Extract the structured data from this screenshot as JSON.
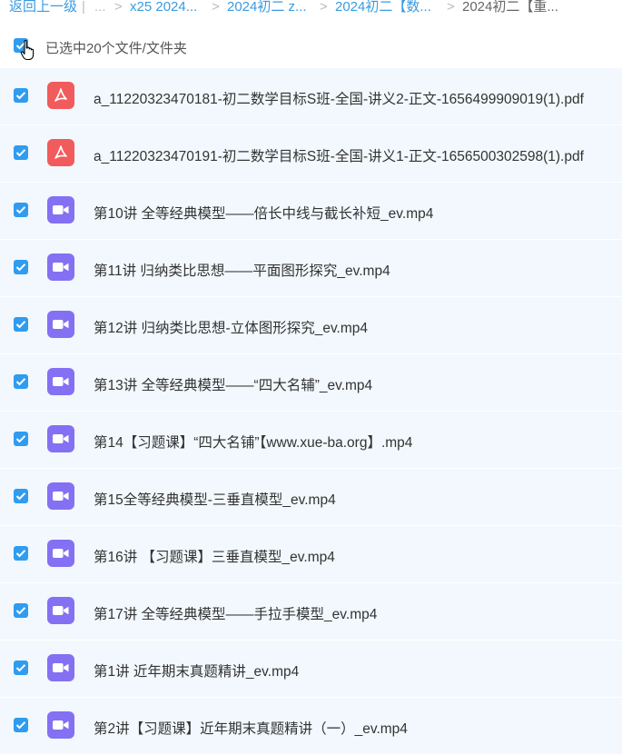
{
  "breadcrumb": {
    "back": "返回上一级",
    "pipe": "|",
    "ellipsis": "...",
    "crumbs": [
      "x25 2024...",
      "2024初二 z...",
      "2024初二【数...",
      "2024初二【重..."
    ]
  },
  "selection": {
    "label": "已选中20个文件/文件夹"
  },
  "files": [
    {
      "name": "a_11220323470181-初二数学目标S班-全国-讲义2-正文-1656499909019(1).pdf",
      "type": "pdf"
    },
    {
      "name": "a_11220323470191-初二数学目标S班-全国-讲义1-正文-1656500302598(1).pdf",
      "type": "pdf"
    },
    {
      "name": "第10讲 全等经典模型——倍长中线与截长补短_ev.mp4",
      "type": "video"
    },
    {
      "name": "第11讲 归纳类比思想——平面图形探究_ev.mp4",
      "type": "video"
    },
    {
      "name": "第12讲 归纳类比思想-立体图形探究_ev.mp4",
      "type": "video"
    },
    {
      "name": "第13讲 全等经典模型——“四大名辅”_ev.mp4",
      "type": "video"
    },
    {
      "name": "第14【习题课】“四大名铺”【www.xue-ba.org】.mp4",
      "type": "video"
    },
    {
      "name": "第15全等经典模型-三垂直模型_ev.mp4",
      "type": "video"
    },
    {
      "name": "第16讲 【习题课】三垂直模型_ev.mp4",
      "type": "video"
    },
    {
      "name": "第17讲 全等经典模型——手拉手模型_ev.mp4",
      "type": "video"
    },
    {
      "name": "第1讲 近年期末真题精讲_ev.mp4",
      "type": "video"
    },
    {
      "name": "第2讲【习题课】近年期末真题精讲（一）_ev.mp4",
      "type": "video"
    }
  ],
  "colors": {
    "link": "#3a9be0",
    "checkbox": "#2f9cf0",
    "pdf_icon": "#f25b5b",
    "video_icon": "#8470f3",
    "row_bg": "#f2f8fd"
  }
}
